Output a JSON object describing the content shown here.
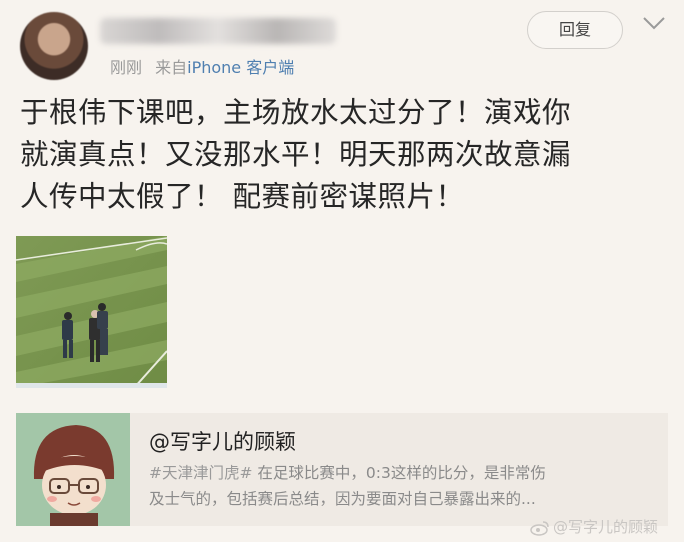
{
  "post": {
    "username_hidden": "",
    "time": "刚刚",
    "from_prefix": "来自",
    "source": "iPhone 客户端",
    "reply_label": "回复",
    "text_lines": [
      "于根伟下课吧，主场放水太过分了！演戏你",
      "就演真点！又没那水平！明天那两次故意漏",
      "人传中太假了！ 配赛前密谋照片！"
    ]
  },
  "quote": {
    "title": "@写字儿的顾颖",
    "topic": "#天津津门虎#",
    "body_line1": " 在足球比赛中，0:3这样的比分，是非常伤",
    "body_line2": "及士气的，包括赛后总结，因为要面对自己暴露出来的..."
  },
  "watermark": {
    "text": "@写字儿的顾颖"
  },
  "colors": {
    "background": "#f7f3ee",
    "link": "#4f7fb0",
    "card": "#efeae4"
  },
  "icons": [
    "chevron-down-icon",
    "weibo-logo-icon"
  ]
}
